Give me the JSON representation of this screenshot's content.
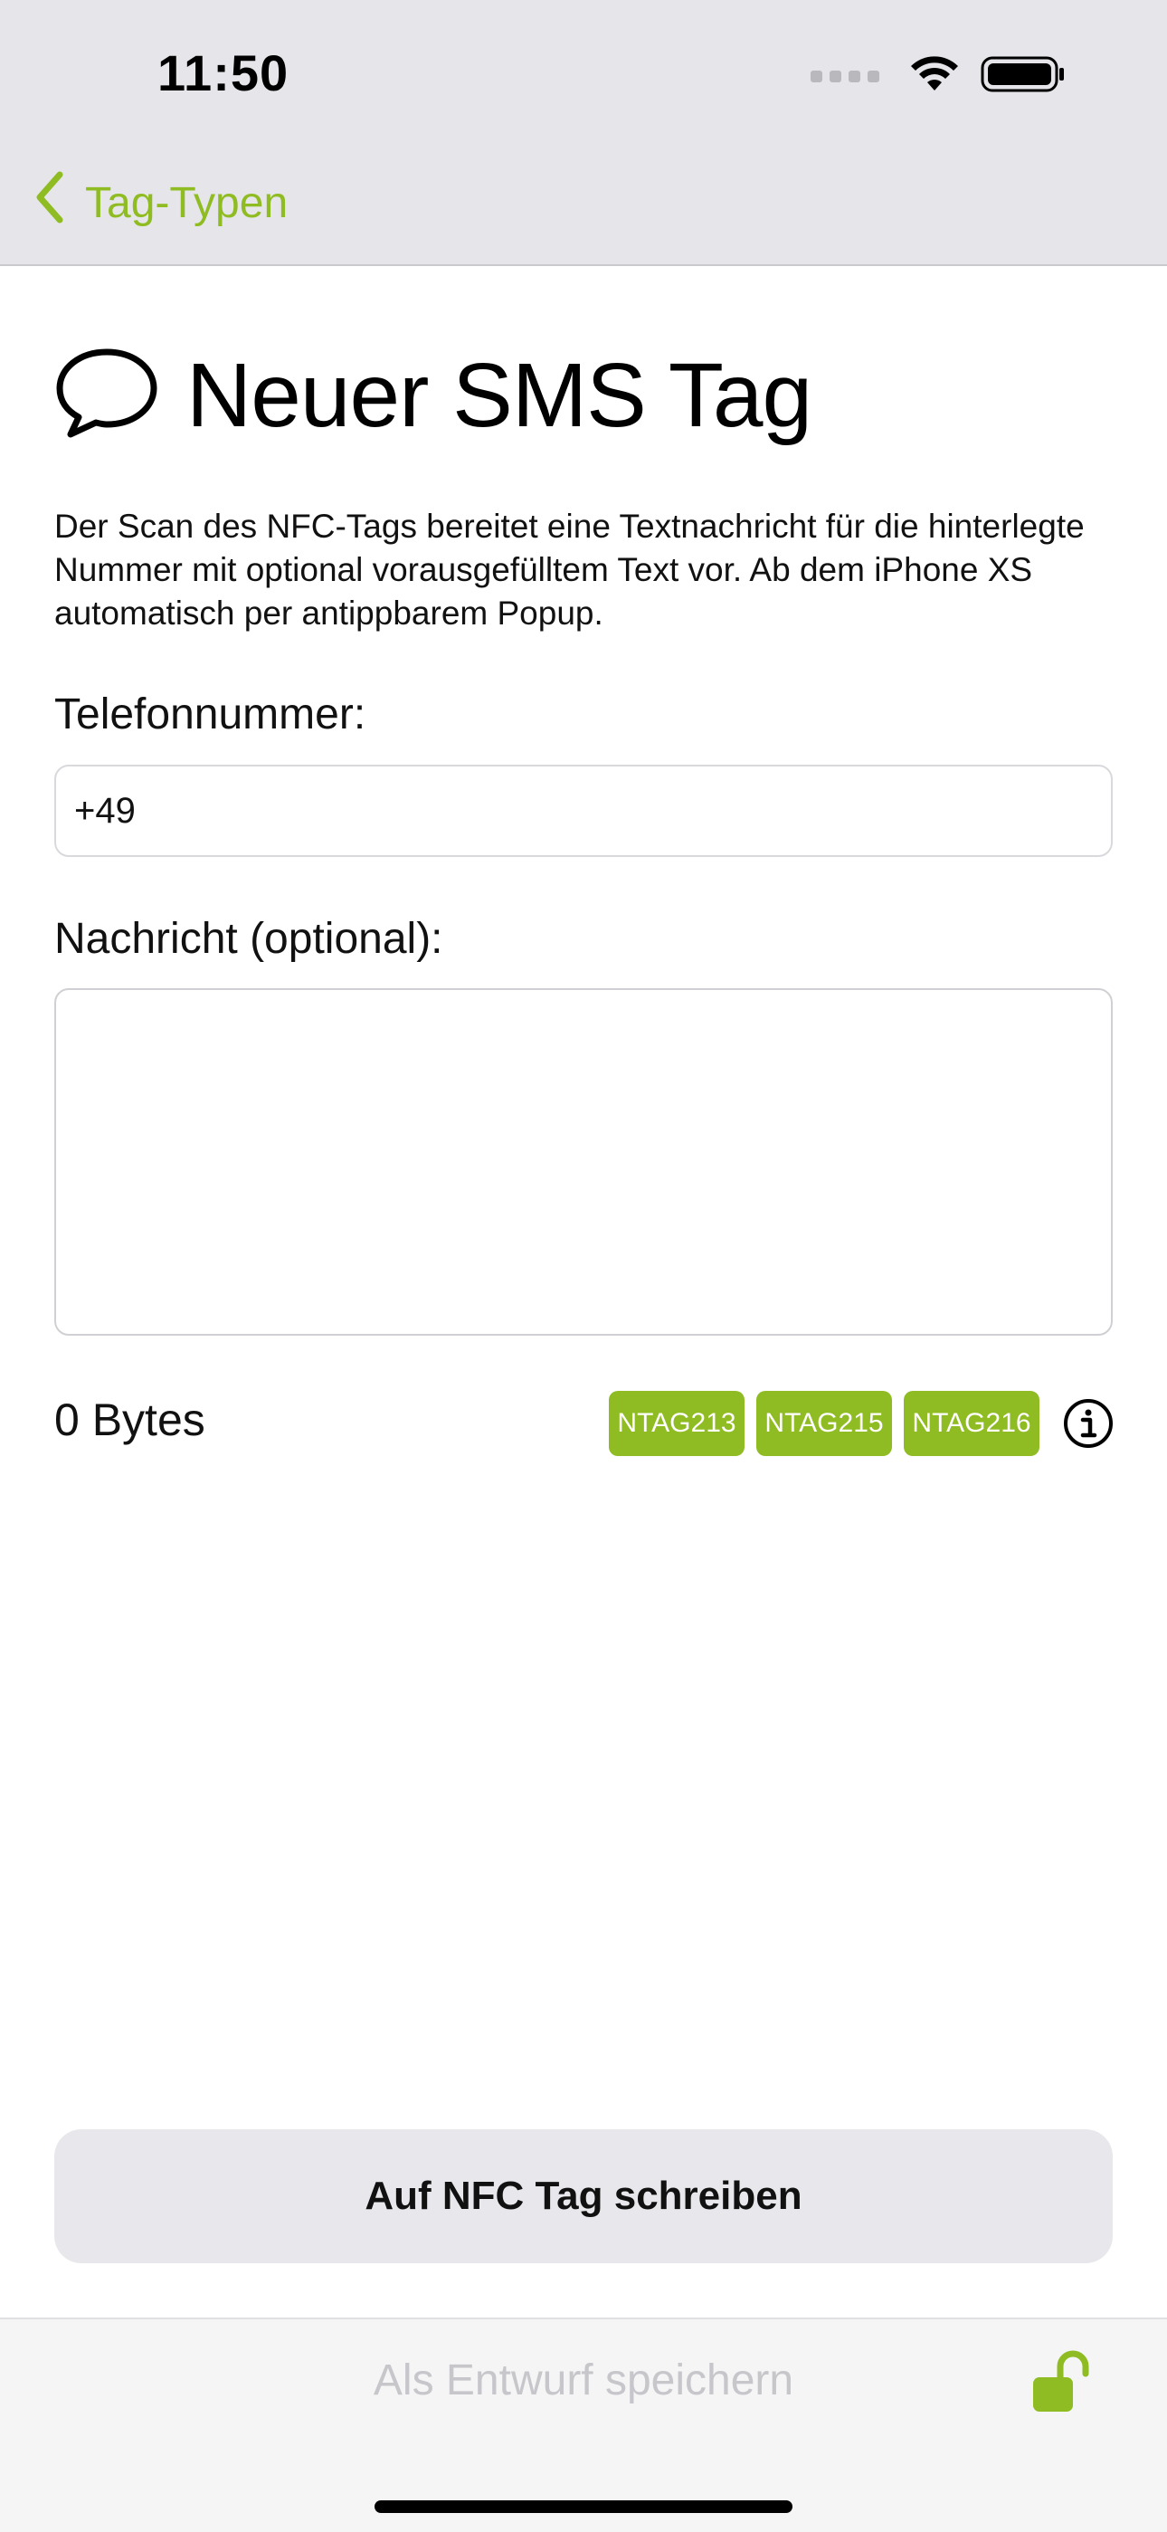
{
  "status_bar": {
    "time": "11:50"
  },
  "nav": {
    "back_label": "Tag-Typen"
  },
  "page": {
    "title": "Neuer SMS Tag",
    "description": "Der Scan des NFC-Tags bereitet eine Textnachricht für die hinterlegte Nummer mit optional vorausgefülltem Text vor. Ab dem iPhone XS automatisch per antippbarem Popup."
  },
  "form": {
    "phone_label": "Telefonnummer:",
    "phone_value": "+49",
    "message_label": "Nachricht (optional):",
    "message_value": ""
  },
  "info": {
    "bytes": "0 Bytes",
    "tags": [
      "NTAG213",
      "NTAG215",
      "NTAG216"
    ]
  },
  "actions": {
    "write_label": "Auf NFC Tag schreiben",
    "draft_label": "Als Entwurf speichern"
  },
  "colors": {
    "accent": "#8fbc22",
    "button_bg": "#e8e8ec",
    "disabled_text": "#c6c6cb"
  }
}
